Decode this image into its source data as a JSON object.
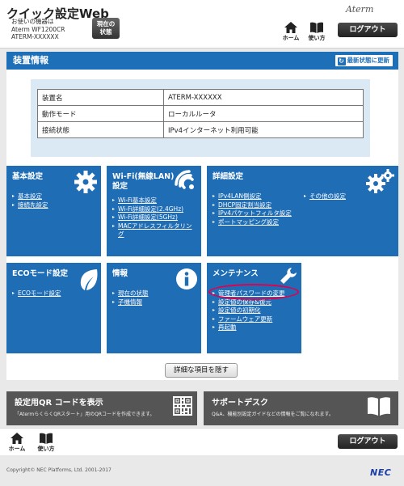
{
  "header": {
    "app_title": "クイック設定Web",
    "device_lines": [
      "お使いの機器は",
      "Aterm WF1200CR",
      "ATERM-XXXXXX"
    ],
    "status_button": [
      "現在の",
      "状態"
    ],
    "brand": "Aterm",
    "home_label": "ホーム",
    "manual_label": "使い方",
    "logout_label": "ログアウト"
  },
  "device_section": {
    "title": "装置情報",
    "refresh_label": "最新状態に更新",
    "rows": [
      {
        "key": "装置名",
        "value": "ATERM-XXXXXX"
      },
      {
        "key": "動作モード",
        "value": "ローカルルータ"
      },
      {
        "key": "接続状態",
        "value": "IPv4インターネット利用可能"
      }
    ]
  },
  "tiles": {
    "basic": {
      "title": "基本設定",
      "links": [
        "基本設定",
        "接続先設定"
      ],
      "icon": "gear-icon"
    },
    "wifi": {
      "title": "Wi-Fi(無線LAN)設定",
      "links": [
        "Wi-Fi基本設定",
        "Wi-Fi詳細設定(2.4GHz)",
        "Wi-Fi詳細設定(5GHz)",
        "MACアドレスフィルタリング"
      ],
      "icon": "wifi-icon"
    },
    "advanced": {
      "title": "詳細設定",
      "links": [
        "IPv4LAN側設定",
        "DHCP固定割当設定",
        "IPv4パケットフィルタ設定",
        "ポートマッピング設定"
      ],
      "links_right": [
        "その他の設定"
      ],
      "icon": "gears-icon"
    },
    "eco": {
      "title": "ECOモード設定",
      "links": [
        "ECOモード設定"
      ],
      "icon": "leaf-icon"
    },
    "info": {
      "title": "情報",
      "links": [
        "現在の状態",
        "子機情報"
      ],
      "icon": "info-icon"
    },
    "maint": {
      "title": "メンテナンス",
      "links": [
        "管理者パスワードの変更",
        "設定値の保存&復元",
        "設定値の初期化",
        "ファームウェア更新",
        "再起動"
      ],
      "icon": "wrench-icon"
    }
  },
  "toggle_label": "詳細な項目を隠す",
  "banners": {
    "qr": {
      "title": "設定用QR コードを表示",
      "desc": "「AtermらくらくQRスタート」用のQRコードを作成できます。",
      "icon": "qr-code-icon"
    },
    "support": {
      "title": "サポートデスク",
      "desc": "Q&A、機能別設定ガイドなどの情報をご覧になれます。",
      "icon": "book-icon"
    }
  },
  "footer": {
    "home_label": "ホーム",
    "manual_label": "使い方",
    "logout_label": "ログアウト",
    "copyright": "Copyright© NEC Platforms, Ltd. 2001-2017",
    "logo": "NEC"
  },
  "colors": {
    "tile_blue": "#1f6db5",
    "section_blue": "#1d6fb8",
    "highlight": "#e0004f",
    "banner_gray": "#555555"
  }
}
